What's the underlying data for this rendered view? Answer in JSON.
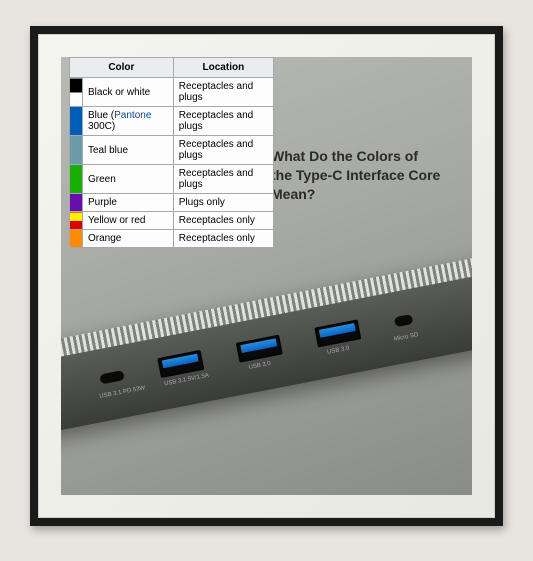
{
  "title_line1": "What Do the Colors of",
  "title_line2": "the Type-C Interface Core Mean?",
  "table": {
    "headers": {
      "color": "Color",
      "location": "Location"
    },
    "rows": [
      {
        "swatch": [
          "#000000",
          "#ffffff"
        ],
        "color_text_pre": "Black or white",
        "link": "",
        "color_text_post": "",
        "location": "Receptacles and plugs"
      },
      {
        "swatch": [
          "#005eb8"
        ],
        "color_text_pre": "Blue (",
        "link": "Pantone",
        "color_text_post": " 300C)",
        "location": "Receptacles and plugs"
      },
      {
        "swatch": [
          "#6b9aa8"
        ],
        "color_text_pre": "Teal blue",
        "link": "",
        "color_text_post": "",
        "location": "Receptacles and plugs"
      },
      {
        "swatch": [
          "#18b000"
        ],
        "color_text_pre": "Green",
        "link": "",
        "color_text_post": "",
        "location": "Receptacles and plugs"
      },
      {
        "swatch": [
          "#6a0dad"
        ],
        "color_text_pre": "Purple",
        "link": "",
        "color_text_post": "",
        "location": "Plugs only"
      },
      {
        "swatch": [
          "#fff000",
          "#e00000"
        ],
        "color_text_pre": "Yellow or red",
        "link": "",
        "color_text_post": "",
        "location": "Receptacles only"
      },
      {
        "swatch": [
          "#ff8c00"
        ],
        "color_text_pre": "Orange",
        "link": "",
        "color_text_post": "",
        "location": "Receptacles only"
      }
    ]
  },
  "hub": {
    "port_labels": [
      "USB 3.1 PD 53W",
      "USB 3.1 5V/1.5A",
      "USB 3.0",
      "USB 3.0",
      "Micro SD"
    ]
  }
}
